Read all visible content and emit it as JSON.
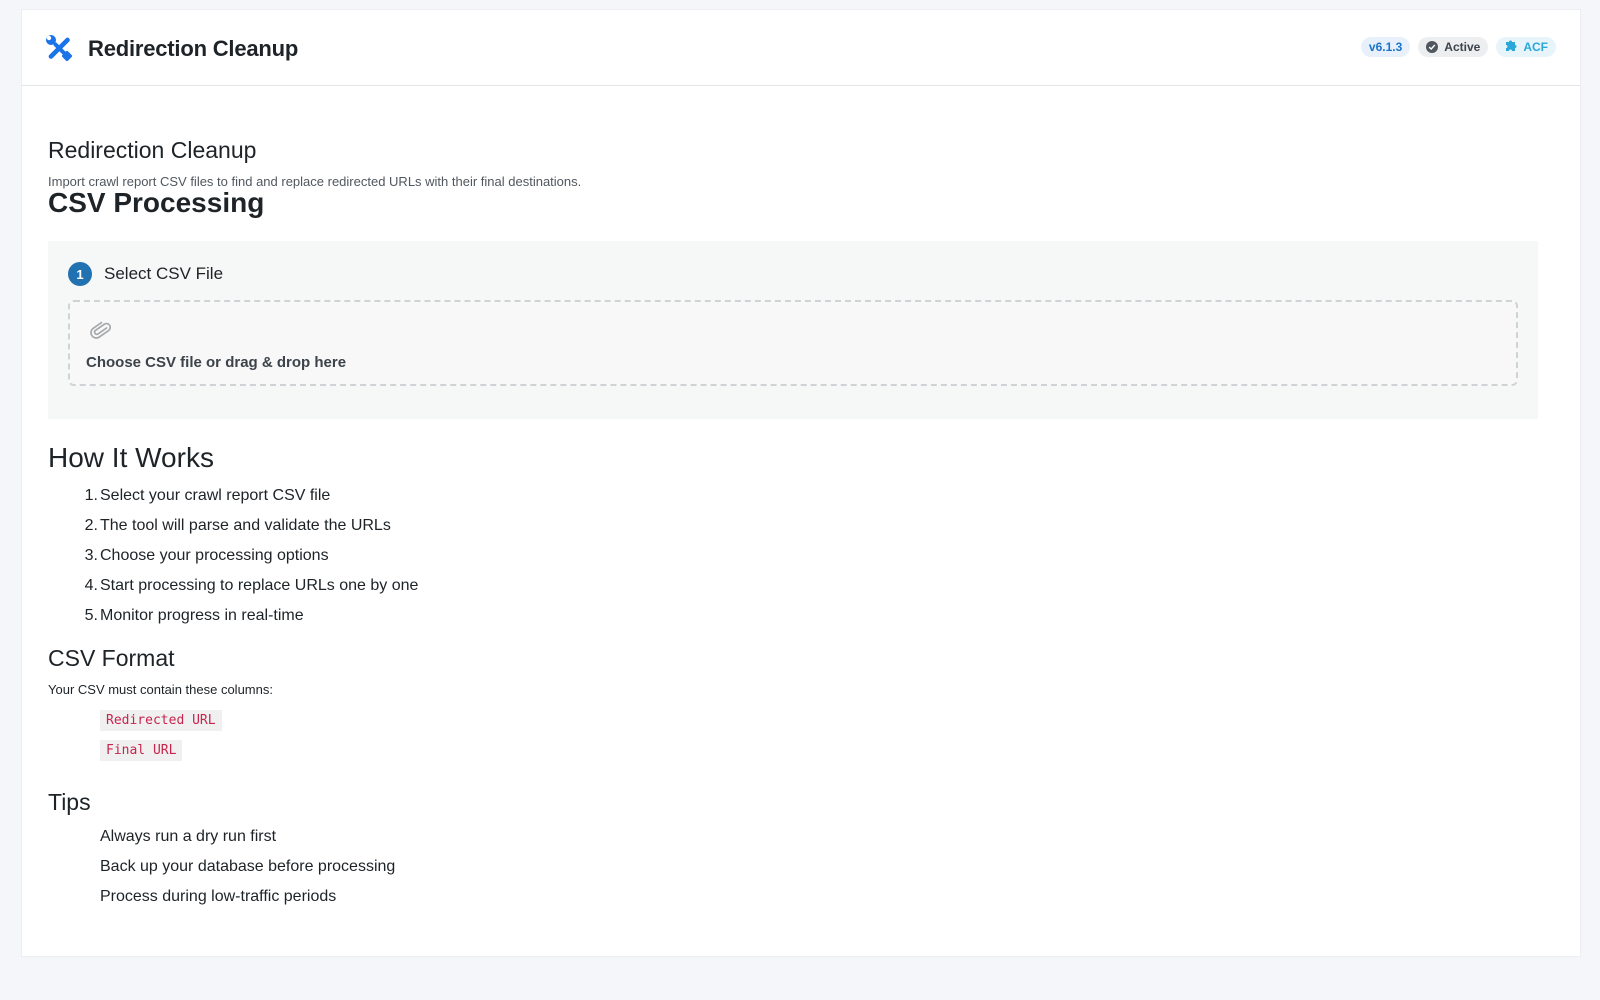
{
  "header": {
    "logo_icon": "tools-icon",
    "title": "Redirection Cleanup",
    "badges": {
      "version": "v6.1.3",
      "status": "Active",
      "status_icon": "check-circle-icon",
      "acf": "ACF",
      "acf_icon": "puzzle-icon"
    }
  },
  "page": {
    "heading": "Redirection Cleanup",
    "description": "Import crawl report CSV files to find and replace redirected URLs with their final destinations."
  },
  "csv_processing": {
    "title": "CSV Processing",
    "step_number": "1",
    "step_label": "Select CSV File",
    "dropzone_icon": "paperclip-icon",
    "dropzone_text": "Choose CSV file or drag & drop here"
  },
  "how_it_works": {
    "title": "How It Works",
    "items": [
      "Select your crawl report CSV file",
      "The tool will parse and validate the URLs",
      "Choose your processing options",
      "Start processing to replace URLs one by one",
      "Monitor progress in real-time"
    ]
  },
  "csv_format": {
    "title": "CSV Format",
    "intro": "Your CSV must contain these columns:",
    "columns": [
      "Redirected URL",
      "Final URL"
    ]
  },
  "tips": {
    "title": "Tips",
    "items": [
      "Always run a dry run first",
      "Back up your database before processing",
      "Process during low-traffic periods"
    ]
  },
  "colors": {
    "accent": "#2271b1",
    "brand_icon": "#1a73e8",
    "code": "#c7254e"
  }
}
